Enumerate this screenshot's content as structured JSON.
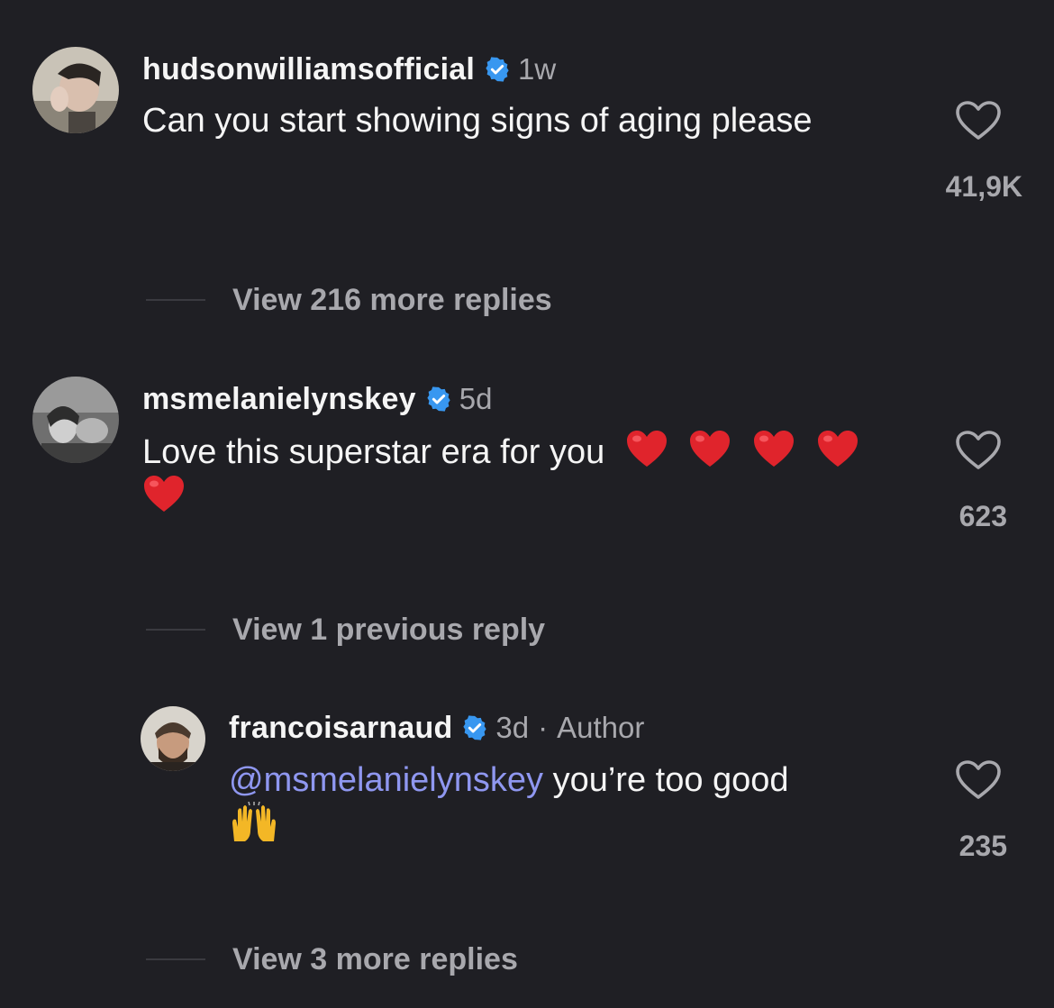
{
  "comments": [
    {
      "username": "hudsonwilliamsofficial",
      "time": "1w",
      "text": "Can you start showing signs of aging please",
      "likes": "41,9K",
      "replies_label": "View 216 more replies"
    },
    {
      "username": "msmelanielynskey",
      "time": "5d",
      "text": "Love this superstar era for you",
      "emoji": "red-heart x5",
      "likes": "623",
      "replies_label": "View 1 previous reply"
    }
  ],
  "reply": {
    "username": "francoisarnaud",
    "time": "3d",
    "separator": "·",
    "author_tag": "Author",
    "mention": "@msmelanielynskey",
    "text": "you’re too good",
    "emoji": "raising-hands",
    "likes": "235",
    "replies_label": "View 3 more replies"
  },
  "colors": {
    "background": "#1f1f24",
    "verified_badge": "#3897f0",
    "mention": "#8f97f0",
    "secondary_text": "#a8a8ad"
  }
}
